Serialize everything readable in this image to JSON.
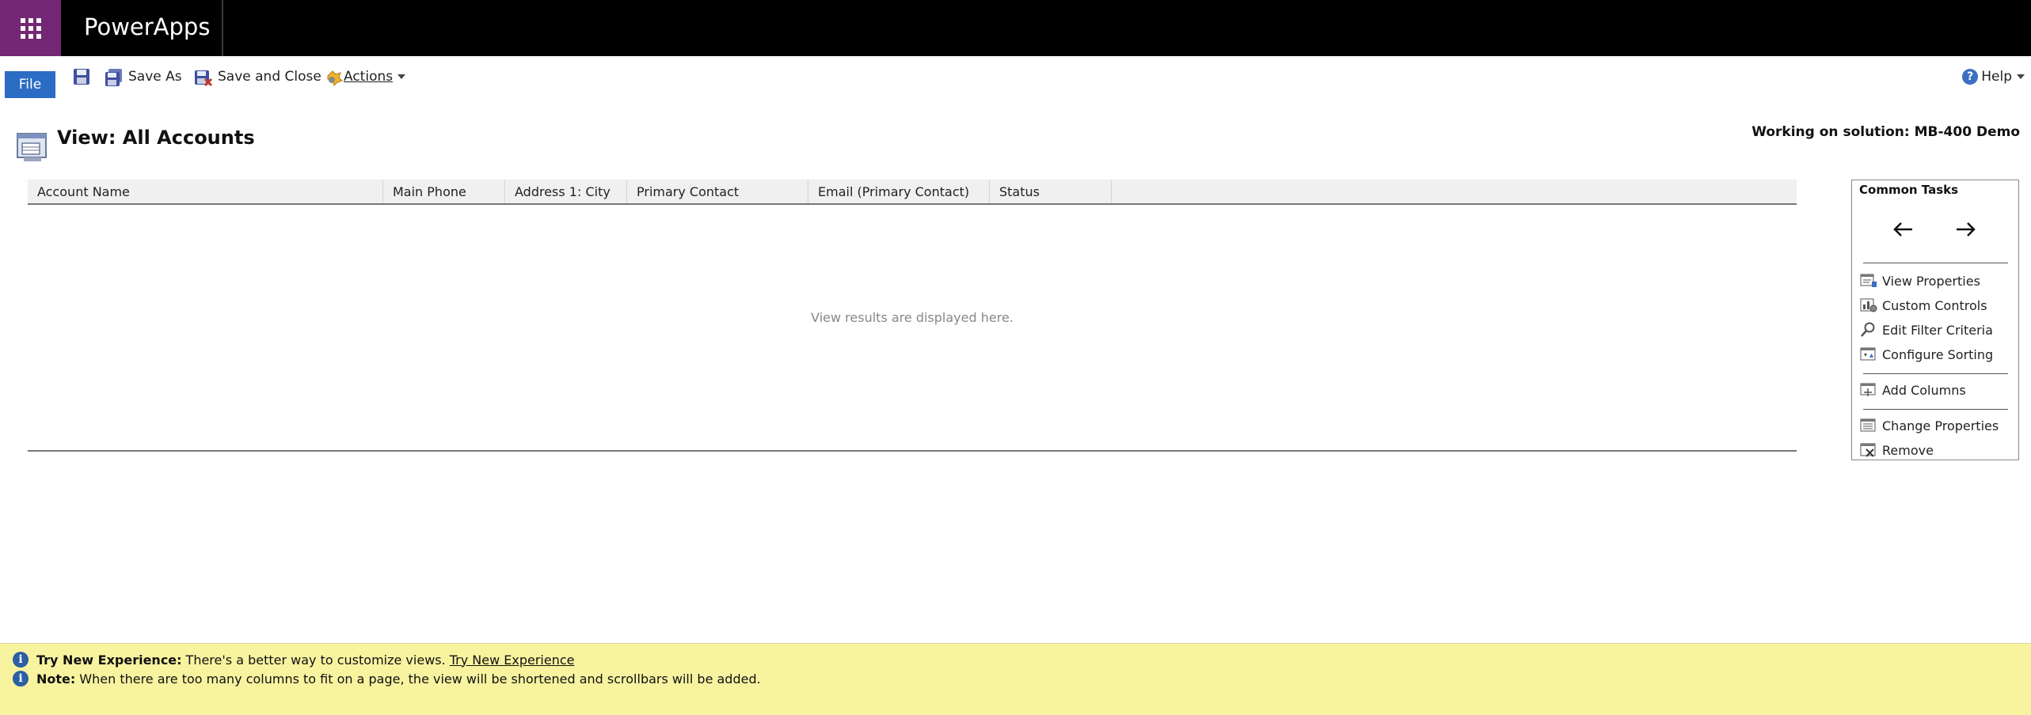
{
  "app": {
    "title": "PowerApps"
  },
  "ribbon": {
    "file": "File",
    "save_as": "Save As",
    "save_and_close": "Save and Close",
    "actions": "Actions",
    "help": "Help"
  },
  "view": {
    "title": "View: All Accounts",
    "solution": "Working on solution: MB-400 Demo"
  },
  "grid": {
    "columns": [
      "Account Name",
      "Main Phone",
      "Address 1: City",
      "Primary Contact",
      "Email (Primary Contact)",
      "Status"
    ],
    "empty_message": "View results are displayed here."
  },
  "tasks": {
    "title": "Common Tasks",
    "items": [
      "View Properties",
      "Custom Controls",
      "Edit Filter Criteria",
      "Configure Sorting",
      "Add Columns",
      "Change Properties",
      "Remove"
    ]
  },
  "notices": [
    {
      "label": "Try New Experience:",
      "text": "There's a better way to customize views.",
      "link": "Try New Experience"
    },
    {
      "label": "Note:",
      "text": "When there are too many columns to fit on a page, the view will be shortened and scrollbars will be added."
    }
  ],
  "colors": {
    "brand": "#742774",
    "file_button": "#2b6cc4",
    "notice_bg": "#f8f39f"
  }
}
